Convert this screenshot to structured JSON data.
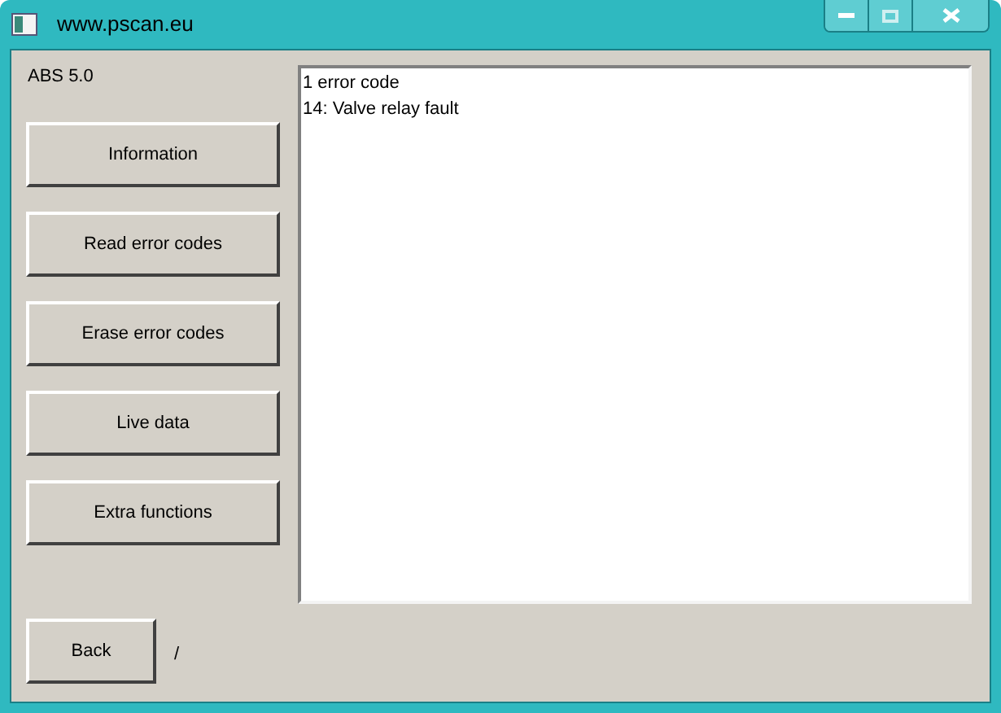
{
  "window": {
    "title": "www.pscan.eu"
  },
  "module_label": "ABS 5.0",
  "buttons": [
    {
      "label": "Information"
    },
    {
      "label": "Read error codes"
    },
    {
      "label": "Erase error codes"
    },
    {
      "label": "Live data"
    },
    {
      "label": "Extra functions"
    }
  ],
  "output_lines": [
    "1 error code",
    "14: Valve relay fault"
  ],
  "back_button": {
    "label": "Back"
  },
  "status_text": "/"
}
